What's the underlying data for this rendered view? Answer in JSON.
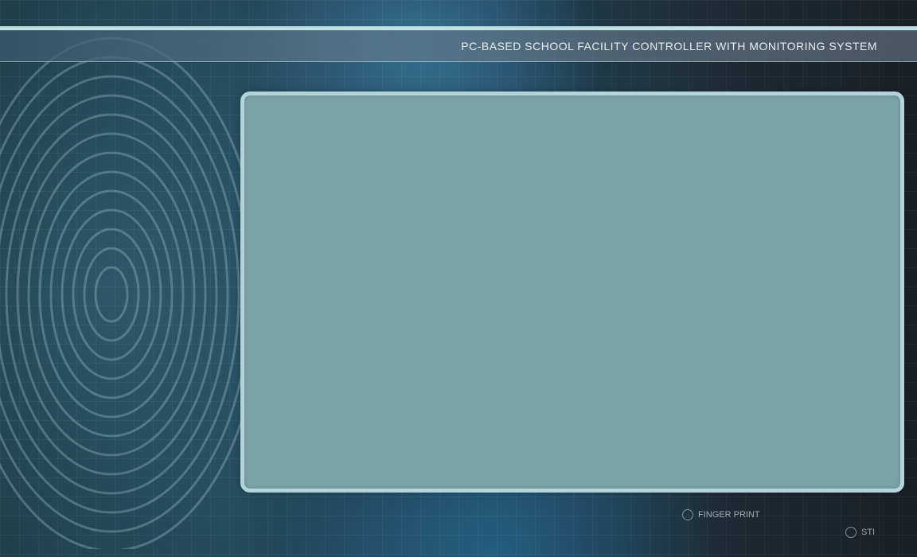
{
  "header": {
    "title": "PC-BASED SCHOOL FACILITY CONTROLLER WITH MONITORING SYSTEM"
  },
  "options": [
    {
      "label": "FINGER PRINT",
      "selected": false
    },
    {
      "label": "STI",
      "selected": false
    }
  ],
  "colors": {
    "panel": "#7ba2a9",
    "panel_border": "#b2d4da",
    "header_line": "#bfe1e6",
    "title_text": "#e6eef2"
  }
}
